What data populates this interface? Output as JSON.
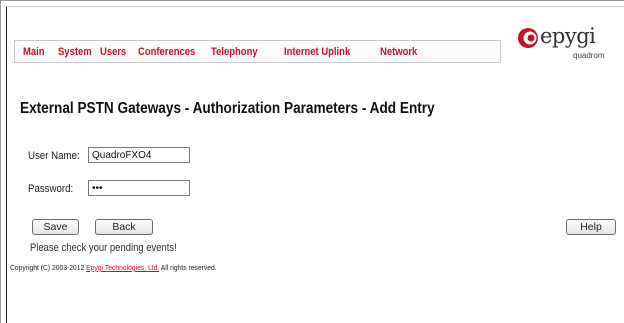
{
  "menu": {
    "items": [
      {
        "label": "Main"
      },
      {
        "label": "System"
      },
      {
        "label": "Users"
      },
      {
        "label": "Conferences"
      },
      {
        "label": "Telephony"
      },
      {
        "label": "Internet Uplink"
      },
      {
        "label": "Network"
      }
    ],
    "color": "#c8102e"
  },
  "logo": {
    "text": "epygi",
    "subtitle": "quadrom",
    "icon": "epygi-logo-icon"
  },
  "page": {
    "title": "External PSTN Gateways - Authorization Parameters - Add Entry"
  },
  "form": {
    "username_label": "User Name:",
    "username_value": "QuadroFXO4",
    "password_label": "Password:",
    "password_value": "•••"
  },
  "buttons": {
    "save": "Save",
    "back": "Back",
    "help": "Help"
  },
  "footer": {
    "pending_events": "Please check your pending events!",
    "copyright_prefix": "Copyright (C) 2003-2012 ",
    "copyright_company": "Epygi Technologies, Ltd.",
    "copyright_suffix": " All rights reserved."
  }
}
